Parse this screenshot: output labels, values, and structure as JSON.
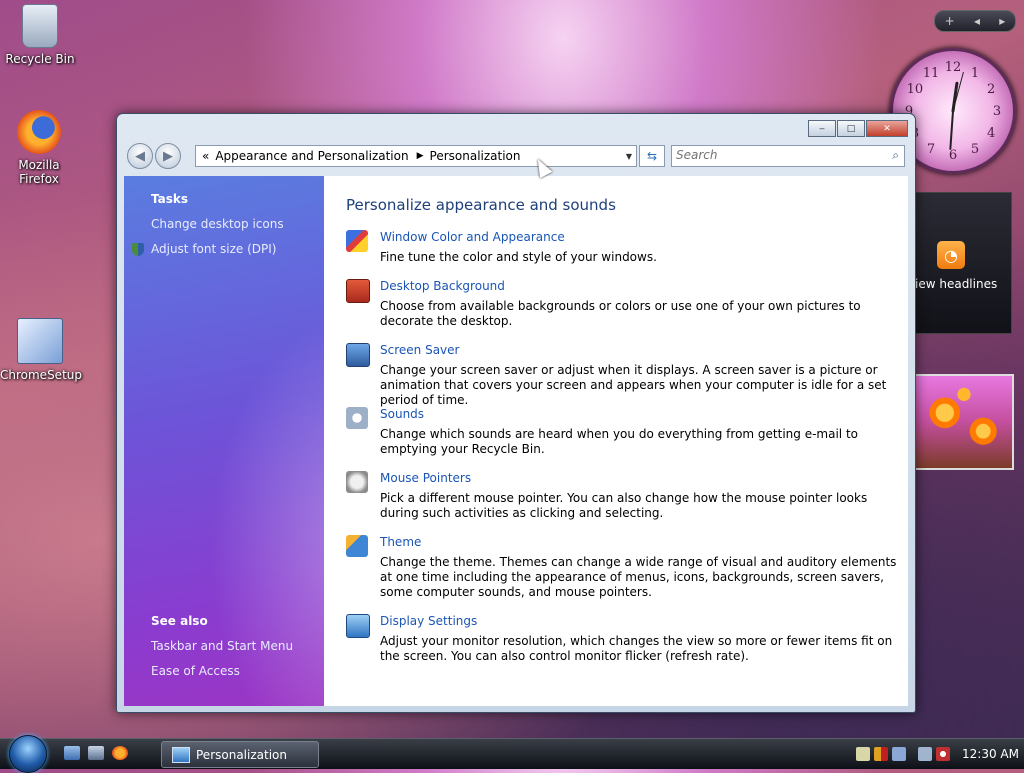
{
  "desktop": {
    "icons": [
      {
        "label": "Recycle Bin"
      },
      {
        "label": "Mozilla Firefox"
      },
      {
        "label": "ChromeSetup"
      }
    ]
  },
  "gadgets": {
    "rss_label": "iew headlines",
    "rss_symbol": "◔",
    "clock_numbers": [
      "12",
      "1",
      "2",
      "3",
      "4",
      "5",
      "6",
      "7",
      "8",
      "9",
      "10",
      "11"
    ],
    "toolbar": {
      "add": "+",
      "prev": "◂",
      "next": "▸"
    }
  },
  "window": {
    "caption": {
      "minimize": "‒",
      "maximize": "□",
      "close": "✕"
    },
    "nav": {
      "back": "◀",
      "forward": "▶",
      "refresh": "⇆",
      "dropdown": "▼"
    },
    "address": {
      "prefix": "«",
      "parts": [
        "Appearance and Personalization",
        "Personalization"
      ],
      "separator": "▶"
    },
    "search": {
      "placeholder": "Search",
      "icon": "⌕"
    },
    "sidebar": {
      "tasks_heading": "Tasks",
      "tasks": [
        "Change desktop icons",
        "Adjust font size (DPI)"
      ],
      "see_also_heading": "See also",
      "see_also": [
        "Taskbar and Start Menu",
        "Ease of Access"
      ]
    },
    "content": {
      "title": "Personalize appearance and sounds",
      "items": [
        {
          "link": "Window Color and Appearance",
          "desc": "Fine tune the color and style of your windows."
        },
        {
          "link": "Desktop Background",
          "desc": "Choose from available backgrounds or colors or use one of your own pictures to decorate the desktop."
        },
        {
          "link": "Screen Saver",
          "desc": "Change your screen saver or adjust when it displays. A screen saver is a picture or animation that covers your screen and appears when your computer is idle for a set period of time."
        },
        {
          "link": "Sounds",
          "desc": "Change which sounds are heard when you do everything from getting e-mail to emptying your Recycle Bin."
        },
        {
          "link": "Mouse Pointers",
          "desc": "Pick a different mouse pointer. You can also change how the mouse pointer looks during such activities as clicking and selecting."
        },
        {
          "link": "Theme",
          "desc": "Change the theme. Themes can change a wide range of visual and auditory elements at one time including the appearance of menus, icons, backgrounds, screen savers, some computer sounds, and mouse pointers."
        },
        {
          "link": "Display Settings",
          "desc": "Adjust your monitor resolution, which changes the view so more or fewer items fit on the screen. You can also control monitor flicker (refresh rate)."
        }
      ]
    }
  },
  "taskbar": {
    "task_label": "Personalization",
    "clock": "12:30 AM"
  }
}
